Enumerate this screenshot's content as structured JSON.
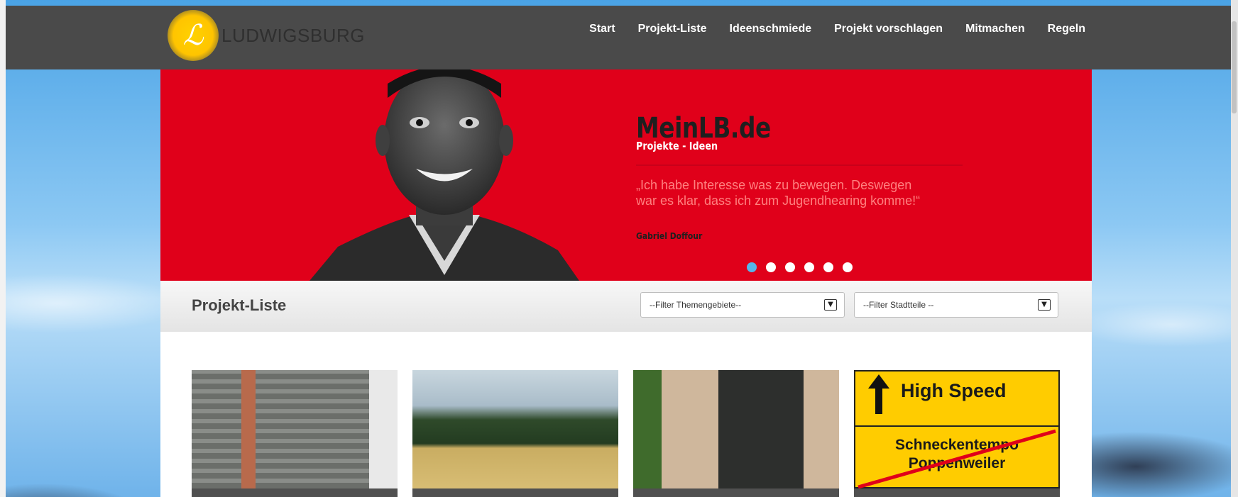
{
  "header": {
    "logo_text": "LUDWIGSBURG",
    "nav": [
      "Start",
      "Projekt-Liste",
      "Ideenschmiede",
      "Projekt vorschlagen",
      "Mitmachen",
      "Regeln"
    ]
  },
  "hero": {
    "title": "MeinLB.de",
    "subtitle": "Projekte - Ideen",
    "quote": "„Ich habe Interesse was zu bewegen. Deswegen war es klar, dass ich zum Jugendhearing komme!“",
    "author": "Gabriel Doffour",
    "slides_total": 6,
    "slide_active": 1
  },
  "list": {
    "title": "Projekt-Liste",
    "filter_theme": "--Filter Themengebiete--",
    "filter_district": "--Filter Stadtteile --"
  },
  "tiles": {
    "sign_top": "High Speed",
    "sign_line1": "Schneckentempo",
    "sign_line2": "Poppenweiler"
  },
  "colors": {
    "header_bg": "#4a4a4a",
    "hero_red": "#e0001a",
    "active_dot": "#56b6ea",
    "logo_yellow": "#ffc400"
  }
}
